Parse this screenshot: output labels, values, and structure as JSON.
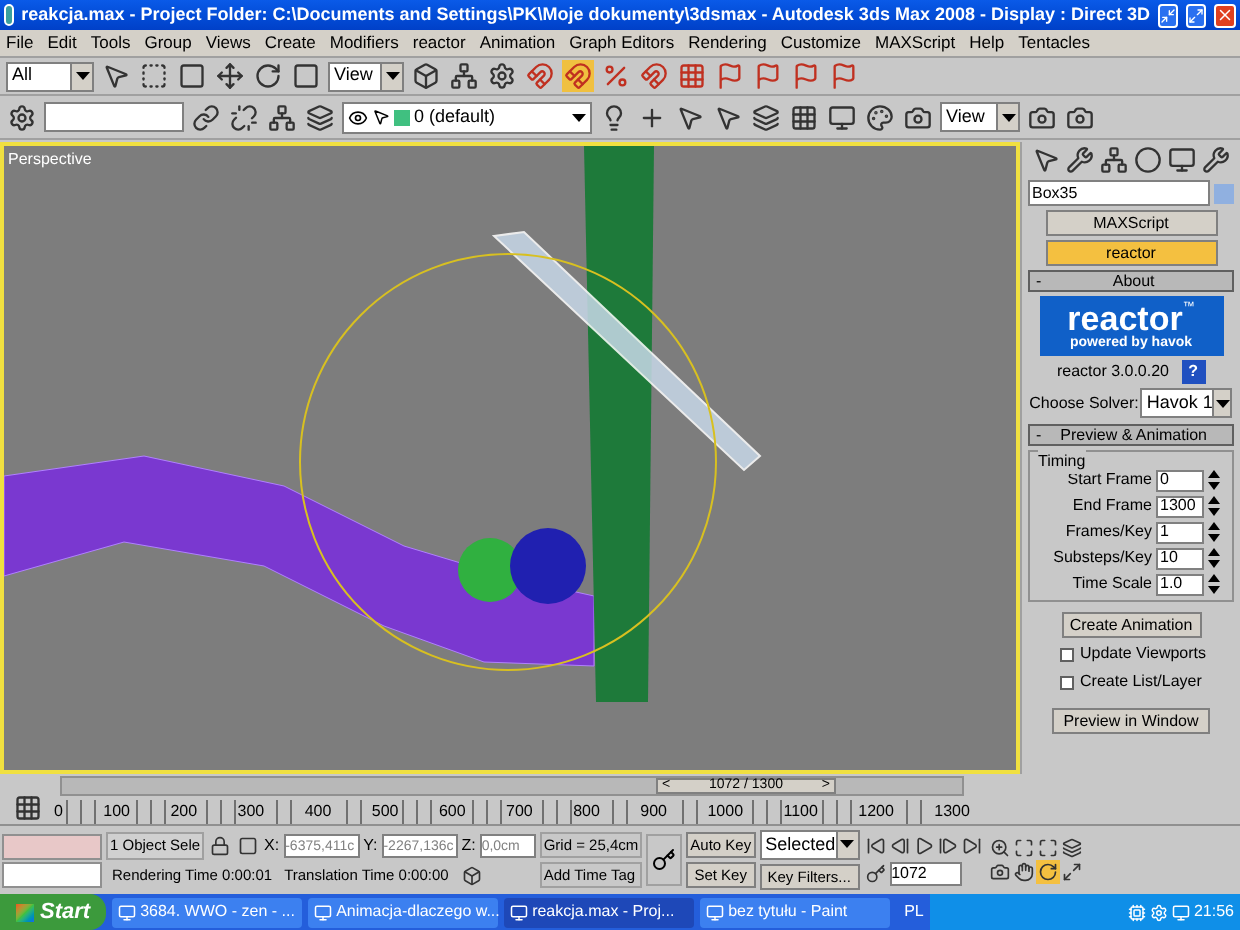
{
  "window": {
    "title": "reakcja.max  - Project Folder: C:\\Documents and Settings\\PK\\Moje dokumenty\\3dsmax   - Autodesk 3ds Max 2008   - Display : Direct 3D"
  },
  "menu": [
    "File",
    "Edit",
    "Tools",
    "Group",
    "Views",
    "Create",
    "Modifiers",
    "reactor",
    "Animation",
    "Graph Editors",
    "Rendering",
    "Customize",
    "MAXScript",
    "Help",
    "Tentacles"
  ],
  "toolbar": {
    "selection_filter": "All",
    "reference_coordinate": "View",
    "layer": "0 (default)",
    "viewport_view": "View"
  },
  "viewport": {
    "label": "Perspective"
  },
  "command_panel": {
    "object_name": "Box35",
    "utility_buttons": [
      {
        "label": "MAXScript",
        "selected": false
      },
      {
        "label": "reactor",
        "selected": true
      }
    ],
    "about": {
      "title": "About",
      "collapse": "-",
      "logo": "reactor",
      "trademark": "™",
      "tagline": "powered by havok",
      "version": "reactor 3.0.0.20",
      "help": "?",
      "solver_label": "Choose Solver:",
      "solver": "Havok 1"
    },
    "preview": {
      "title": "Preview & Animation",
      "collapse": "-",
      "group": "Timing",
      "fields": [
        {
          "label": "Start Frame",
          "value": "0"
        },
        {
          "label": "End Frame",
          "value": "1300"
        },
        {
          "label": "Frames/Key",
          "value": "1"
        },
        {
          "label": "Substeps/Key",
          "value": "10"
        },
        {
          "label": "Time Scale",
          "value": "1.0"
        }
      ],
      "create_button": "Create Animation",
      "checkboxes": [
        {
          "label": "Update Viewports",
          "checked": false
        },
        {
          "label": "Create List/Layer",
          "checked": false
        }
      ],
      "preview_button": "Preview in Window"
    }
  },
  "timeline": {
    "slider": "1072 / 1300",
    "prev": "<",
    "next": ">",
    "level": 0.825,
    "ticks": [
      "0",
      "100",
      "200",
      "300",
      "400",
      "500",
      "600",
      "700",
      "800",
      "900",
      "1000",
      "1100",
      "1200",
      "1300"
    ]
  },
  "status_bar": {
    "selection": "1 Object Sele",
    "x_label": "X:",
    "x": "-6375,411c",
    "y_label": "Y:",
    "y": "-2267,136c",
    "z_label": "Z:",
    "z": "0,0cm",
    "grid": "Grid = 25,4cm",
    "rendering_time": "Rendering Time  0:00:01",
    "translation_time": "Translation Time  0:00:00",
    "add_time_tag": "Add Time Tag",
    "auto_key": "Auto Key",
    "set_key": "Set Key",
    "key_mode": "Selected",
    "key_filters": "Key Filters...",
    "frame": "1072"
  },
  "taskbar": {
    "start": "Start",
    "tasks": [
      {
        "label": "3684. WWO - zen - ...",
        "selected": false
      },
      {
        "label": "Animacja-dlaczego w...",
        "selected": false
      },
      {
        "label": "reakcja.max    - Proj...",
        "selected": true
      },
      {
        "label": "bez tytułu - Paint",
        "selected": false
      }
    ],
    "language": "PL",
    "clock": "21:56"
  }
}
